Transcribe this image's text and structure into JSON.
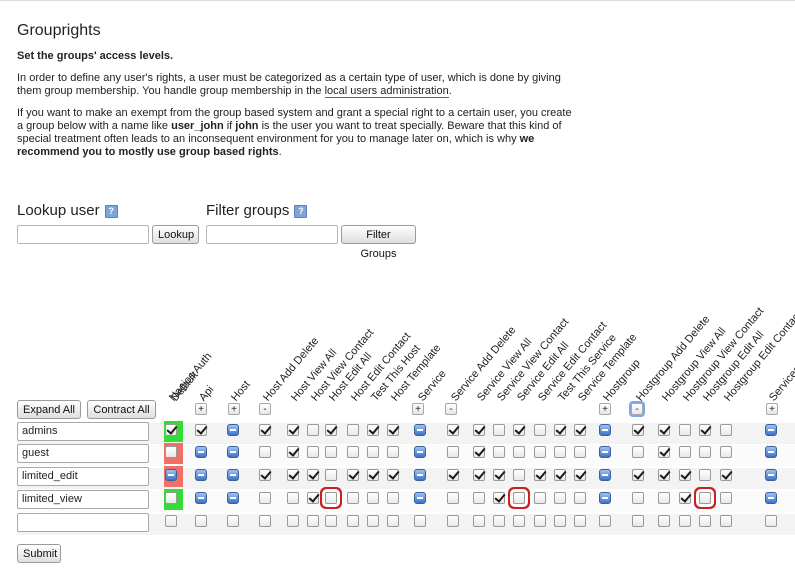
{
  "page": {
    "title": "Grouprights",
    "subtitle": "Set the groups' access levels.",
    "para1_a": "In order to define any user's rights, a user must be categorized as a certain type of user, which is done by giving them group membership. You handle group membership in the ",
    "para1_link": "local users administration",
    "para1_b": ".",
    "para2_a": "If you want to make an exempt from the group based system and grant a special right to a certain user, you create a group below with a name like ",
    "para2_b1": "user_john",
    "para2_c": " if ",
    "para2_b2": "john",
    "para2_d": " is the user you want to treat specially. Beware that this kind of special treatment often leads to an inconsequent environment for you to manage later on, which is why ",
    "para2_b3": "we recommend you to mostly use group based rights",
    "para2_e": "."
  },
  "lookup": {
    "title": "Lookup user",
    "button": "Lookup"
  },
  "filter": {
    "title": "Filter groups",
    "button": "Filter Groups"
  },
  "toolbar": {
    "expand": "Expand All",
    "contract": "Contract All"
  },
  "columns": [
    {
      "label": "Default",
      "kind": "default"
    },
    {
      "label": "Nagios Auth",
      "kind": "col"
    },
    {
      "label": "Api",
      "kind": "col"
    },
    {
      "label": "Host",
      "kind": "group"
    },
    {
      "label": "Host Add Delete",
      "kind": "col"
    },
    {
      "label": "Host View All",
      "kind": "col"
    },
    {
      "label": "Host View Contact",
      "kind": "col"
    },
    {
      "label": "Host Edit All",
      "kind": "col"
    },
    {
      "label": "Host Edit Contact",
      "kind": "col"
    },
    {
      "label": "Test This Host",
      "kind": "col"
    },
    {
      "label": "Host Template",
      "kind": "col"
    },
    {
      "label": "Service",
      "kind": "group"
    },
    {
      "label": "Service Add Delete",
      "kind": "col"
    },
    {
      "label": "Service View All",
      "kind": "col"
    },
    {
      "label": "Service View Contact",
      "kind": "col"
    },
    {
      "label": "Service Edit All",
      "kind": "col"
    },
    {
      "label": "Service Edit Contact",
      "kind": "col"
    },
    {
      "label": "Test This Service",
      "kind": "col"
    },
    {
      "label": "Service Template",
      "kind": "col"
    },
    {
      "label": "Hostgroup",
      "kind": "group"
    },
    {
      "label": "Hostgroup Add Delete",
      "kind": "col"
    },
    {
      "label": "Hostgroup View All",
      "kind": "col"
    },
    {
      "label": "Hostgroup View Contact",
      "kind": "col"
    },
    {
      "label": "Hostgroup Edit All",
      "kind": "col"
    },
    {
      "label": "Hostgroup Edit Contact",
      "kind": "col"
    },
    {
      "label": "Servicegroup",
      "kind": "group"
    }
  ],
  "toggles": [
    "+",
    "+",
    "-",
    "+",
    "-",
    "+",
    "-",
    "+"
  ],
  "rows": [
    {
      "name": "admins",
      "default_color": "#33dd33",
      "cells": [
        1,
        1,
        "g",
        1,
        1,
        0,
        1,
        0,
        1,
        1,
        "g",
        1,
        1,
        0,
        1,
        0,
        1,
        1,
        "g",
        1,
        1,
        0,
        1,
        0,
        "g"
      ]
    },
    {
      "name": "guest",
      "default_color": "#f07068",
      "cells": [
        0,
        "g",
        "g",
        0,
        1,
        0,
        0,
        0,
        0,
        0,
        "g",
        0,
        1,
        0,
        0,
        0,
        0,
        0,
        "g",
        0,
        1,
        0,
        0,
        0,
        "g"
      ]
    },
    {
      "name": "limited_edit",
      "default_color": "#f07068",
      "cells": [
        "g",
        "g",
        "g",
        1,
        1,
        1,
        0,
        1,
        1,
        1,
        "g",
        1,
        1,
        1,
        0,
        1,
        1,
        1,
        "g",
        1,
        1,
        1,
        0,
        1,
        "g"
      ]
    },
    {
      "name": "limited_view",
      "default_color": "#33dd33",
      "cells": [
        0,
        "g",
        "g",
        0,
        0,
        1,
        0,
        0,
        0,
        0,
        "g",
        0,
        0,
        1,
        0,
        0,
        0,
        0,
        "g",
        0,
        0,
        1,
        0,
        0,
        "g"
      ]
    },
    {
      "name": "",
      "default_color": "",
      "cells": [
        0,
        0,
        0,
        0,
        0,
        0,
        0,
        0,
        0,
        0,
        0,
        0,
        0,
        0,
        0,
        0,
        0,
        0,
        0,
        0,
        0,
        0,
        0,
        0,
        0
      ]
    }
  ],
  "highlighted_cells": [
    [
      3,
      6
    ],
    [
      3,
      14
    ],
    [
      3,
      22
    ]
  ],
  "submit": "Submit"
}
